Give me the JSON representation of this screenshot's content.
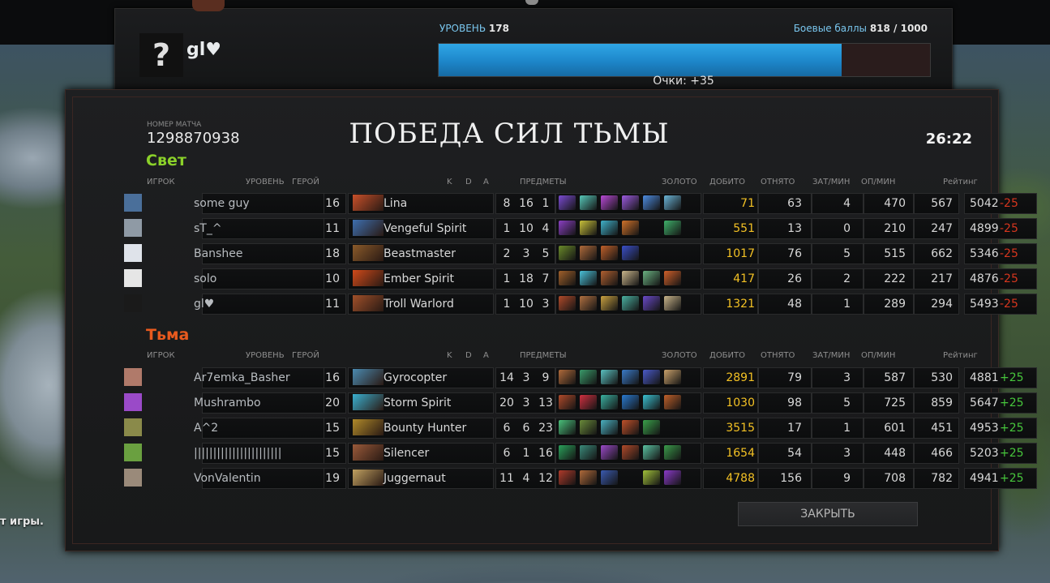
{
  "top": {
    "player_name": "gl♥",
    "avatar_symbol": "?",
    "level_label": "УРОВЕНЬ",
    "level_value": "178",
    "battle_label": "Боевые баллы",
    "battle_value": "818 / 1000",
    "xp_progress": 0.82,
    "points": "Очки: +35"
  },
  "match": {
    "label": "НОМЕР МАТЧА",
    "id": "1298870938",
    "result": "ПОБЕДА СИЛ ТЬМЫ",
    "time": "26:22",
    "close_label": "ЗАКРЫТЬ"
  },
  "hint_text": "т игры.",
  "headers": {
    "player": "ИГРОК",
    "level": "УРОВЕНЬ",
    "hero": "ГЕРОЙ",
    "k": "K",
    "d": "D",
    "a": "A",
    "items": "ПРЕДМЕТЫ",
    "gold": "ЗОЛОТО",
    "lh": "ДОБИТО",
    "dn": "ОТНЯТО",
    "xpm": "ЗАТ/МИН",
    "gpm": "ОП/МИН",
    "rating": "Рейтинг"
  },
  "radiant": {
    "name": "Свет",
    "players": [
      {
        "player": "some guy",
        "level": "16",
        "hero": "Lina",
        "k": "8",
        "d": "16",
        "a": "1",
        "gold": "71",
        "lh": "63",
        "dn": "4",
        "xpm": "470",
        "gpm": "567",
        "rating": "5042",
        "delta": "-25",
        "hero_color": "#c8502a",
        "av_color": "#4a6f9a",
        "items": [
          "#7a4bd1",
          "#56c7b8",
          "#b84ad6",
          "#9c5be0",
          "#4d8ce0",
          "#6ab4d6"
        ]
      },
      {
        "player": "sT_^",
        "level": "11",
        "hero": "Vengeful Spirit",
        "k": "1",
        "d": "10",
        "a": "4",
        "gold": "551",
        "lh": "13",
        "dn": "0",
        "xpm": "210",
        "gpm": "247",
        "rating": "4899",
        "delta": "-25",
        "hero_color": "#3d6fb0",
        "av_color": "#8f9aa5",
        "items": [
          "#8a3fc2",
          "#c8c03a",
          "#3fb0c8",
          "#d0722a",
          "",
          "#3fb06a"
        ]
      },
      {
        "player": "Banshee",
        "level": "18",
        "hero": "Beastmaster",
        "k": "2",
        "d": "3",
        "a": "5",
        "gold": "1017",
        "lh": "76",
        "dn": "5",
        "xpm": "515",
        "gpm": "662",
        "rating": "5346",
        "delta": "-25",
        "hero_color": "#8a5a2a",
        "av_color": "#dfe3ea",
        "items": [
          "#6a8a2a",
          "#b06a3a",
          "#c0602a",
          "#3a4fc8",
          "",
          ""
        ]
      },
      {
        "player": "solo",
        "level": "10",
        "hero": "Ember Spirit",
        "k": "1",
        "d": "18",
        "a": "7",
        "gold": "417",
        "lh": "26",
        "dn": "2",
        "xpm": "222",
        "gpm": "217",
        "rating": "4876",
        "delta": "-25",
        "hero_color": "#d04a1a",
        "av_color": "#e6e6e6",
        "items": [
          "#a0602a",
          "#4ac0d8",
          "#b06030",
          "#c8b48a",
          "#6ab080",
          "#d0602a"
        ]
      },
      {
        "player": "gl♥",
        "level": "11",
        "hero": "Troll Warlord",
        "k": "1",
        "d": "10",
        "a": "3",
        "gold": "1321",
        "lh": "48",
        "dn": "1",
        "xpm": "289",
        "gpm": "294",
        "rating": "5493",
        "delta": "-25",
        "hero_color": "#a0502a",
        "av_color": "#1a1a1a",
        "items": [
          "#b04a2a",
          "#b07040",
          "#c8a040",
          "#4ab0a0",
          "#6a4ac8",
          "#c8b48a"
        ]
      }
    ]
  },
  "dire": {
    "name": "Тьма",
    "players": [
      {
        "player": "Ar7emka_Basher",
        "level": "16",
        "hero": "Gyrocopter",
        "k": "14",
        "d": "3",
        "a": "9",
        "gold": "2891",
        "lh": "79",
        "dn": "3",
        "xpm": "587",
        "gpm": "530",
        "rating": "4881",
        "delta": "+25",
        "hero_color": "#4a8ab0",
        "av_color": "#b07a6a",
        "items": [
          "#b06a3a",
          "#3a9a6a",
          "#5ac0c0",
          "#3a7ac8",
          "#4a5ac8",
          "#c8a06a"
        ]
      },
      {
        "player": "Mushrambo",
        "level": "20",
        "hero": "Storm Spirit",
        "k": "20",
        "d": "3",
        "a": "13",
        "gold": "1030",
        "lh": "98",
        "dn": "5",
        "xpm": "725",
        "gpm": "859",
        "rating": "5647",
        "delta": "+25",
        "hero_color": "#3ab0d0",
        "av_color": "#9a4ac8",
        "items": [
          "#b04a2a",
          "#d03040",
          "#3ab0a0",
          "#2a7ad0",
          "#3ac0d0",
          "#c0602a"
        ]
      },
      {
        "player": "A^2",
        "level": "15",
        "hero": "Bounty Hunter",
        "k": "6",
        "d": "6",
        "a": "23",
        "gold": "3515",
        "lh": "17",
        "dn": "1",
        "xpm": "601",
        "gpm": "451",
        "rating": "4953",
        "delta": "+25",
        "hero_color": "#b08a2a",
        "av_color": "#8a8a4a",
        "items": [
          "#4ac07a",
          "#6a8a3a",
          "#4ab0c0",
          "#c0502a",
          "#3aa04a",
          ""
        ]
      },
      {
        "player": "|||||||||||||||||||||||",
        "level": "15",
        "hero": "Silencer",
        "k": "6",
        "d": "1",
        "a": "16",
        "gold": "1654",
        "lh": "54",
        "dn": "3",
        "xpm": "448",
        "gpm": "466",
        "rating": "5203",
        "delta": "+25",
        "hero_color": "#9a5a3a",
        "av_color": "#6aa040",
        "items": [
          "#2aa05a",
          "#3a8a7a",
          "#9a4ac8",
          "#b04a2a",
          "#5ac0a0",
          "#3a9a4a"
        ]
      },
      {
        "player": "VonValentin",
        "level": "19",
        "hero": "Juggernaut",
        "k": "11",
        "d": "4",
        "a": "12",
        "gold": "4788",
        "lh": "156",
        "dn": "9",
        "xpm": "708",
        "gpm": "782",
        "rating": "4941",
        "delta": "+25",
        "hero_color": "#c0a060",
        "av_color": "#9a8a7a",
        "items": [
          "#b03a2a",
          "#b06a3a",
          "#3a5ab0",
          "",
          "#a0c03a",
          "#8a3ac8"
        ]
      }
    ]
  }
}
